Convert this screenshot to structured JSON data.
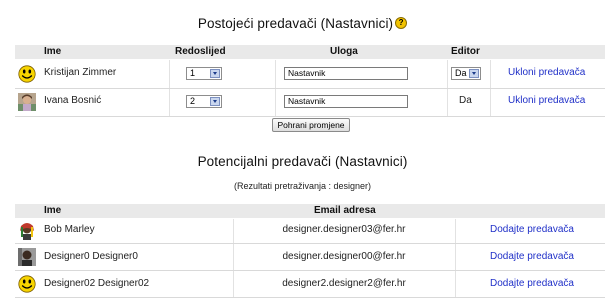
{
  "current": {
    "title": "Postojeći predavači (Nastavnici)",
    "help_glyph": "?",
    "headers": {
      "ime": "Ime",
      "redoslijed": "Redoslijed",
      "uloga": "Uloga",
      "editor": "Editor"
    },
    "rows": [
      {
        "name": "Kristijan Zimmer",
        "order": "1",
        "role": "Nastavnik",
        "editor": "Da",
        "editor_is_select": true,
        "remove": "Ukloni predavača",
        "avatar": "smiley-avatar"
      },
      {
        "name": "Ivana Bosnić",
        "order": "2",
        "role": "Nastavnik",
        "editor": "Da",
        "editor_is_select": false,
        "remove": "Ukloni predavača",
        "avatar": "photo-avatar"
      }
    ],
    "save_label": "Pohrani promjene"
  },
  "potential": {
    "title": "Potencijalni predavači (Nastavnici)",
    "subtitle": "(Rezultati pretraživanja : designer)",
    "headers": {
      "ime": "Ime",
      "email": "Email adresa"
    },
    "rows": [
      {
        "name": "Bob Marley",
        "email": "designer.designer03@fer.hr",
        "add": "Dodajte predavača",
        "avatar": "photo-avatar"
      },
      {
        "name": "Designer0 Designer0",
        "email": "designer.designer00@fer.hr",
        "add": "Dodajte predavača",
        "avatar": "photo-avatar"
      },
      {
        "name": "Designer02 Designer02",
        "email": "designer2.designer2@fer.hr",
        "add": "Dodajte predavača",
        "avatar": "smiley-avatar"
      }
    ]
  },
  "colors": {
    "link": "#2030c8",
    "header_bg": "#e9e9e9",
    "smiley": "#f7d400"
  }
}
